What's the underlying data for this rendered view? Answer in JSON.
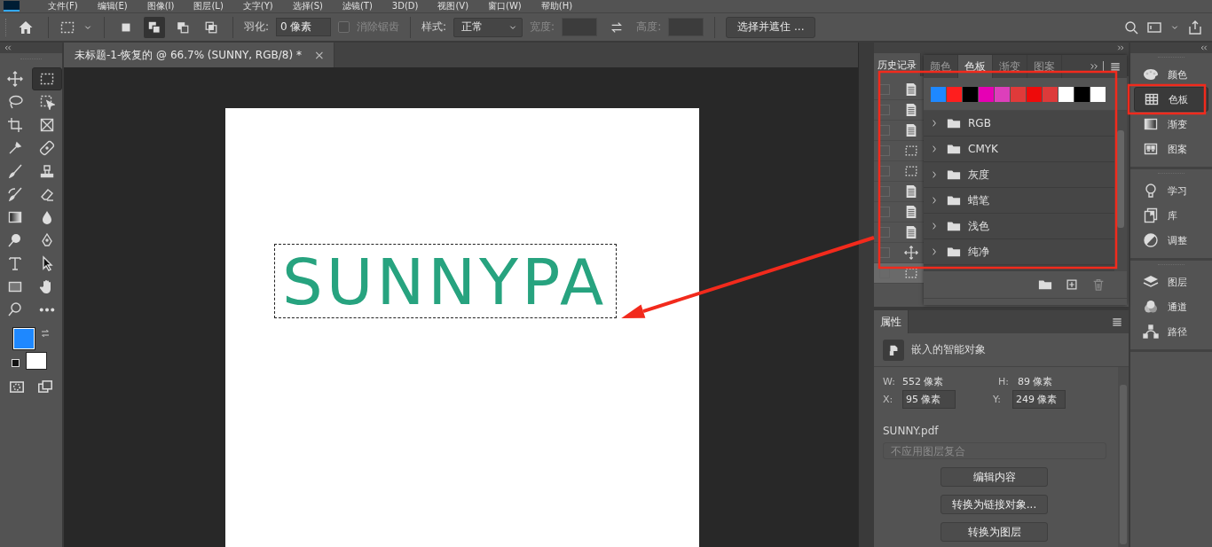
{
  "menu_bar": [
    "文件(F)",
    "编辑(E)",
    "图像(I)",
    "图层(L)",
    "文字(Y)",
    "选择(S)",
    "滤镜(T)",
    "3D(D)",
    "视图(V)",
    "窗口(W)",
    "帮助(H)"
  ],
  "options_bar": {
    "selection_modes": [
      {
        "kind": "new",
        "selected": false
      },
      {
        "kind": "add",
        "selected": true
      },
      {
        "kind": "subtract",
        "selected": false
      },
      {
        "kind": "intersect",
        "selected": false
      }
    ],
    "feather": {
      "label": "羽化:",
      "value": "0 像素"
    },
    "anti_alias": {
      "label": "消除锯齿",
      "checked": false,
      "disabled": true
    },
    "style": {
      "label": "样式:",
      "value": "正常"
    },
    "width": {
      "label": "宽度:",
      "disabled": true
    },
    "height": {
      "label": "高度:",
      "disabled": true
    },
    "select_mask_button": "选择并遮住 ..."
  },
  "tools": [
    {
      "kind": "move",
      "selected": false
    },
    {
      "kind": "marquee",
      "selected": true
    },
    {
      "kind": "lasso",
      "selected": false
    },
    {
      "kind": "object-select",
      "selected": false
    },
    {
      "kind": "crop",
      "selected": false
    },
    {
      "kind": "frame",
      "selected": false
    },
    {
      "kind": "eyedropper",
      "selected": false
    },
    {
      "kind": "healing",
      "selected": false
    },
    {
      "kind": "brush",
      "selected": false
    },
    {
      "kind": "stamp",
      "selected": false
    },
    {
      "kind": "history-brush",
      "selected": false
    },
    {
      "kind": "eraser",
      "selected": false
    },
    {
      "kind": "gradient",
      "selected": false
    },
    {
      "kind": "blur",
      "selected": false
    },
    {
      "kind": "dodge",
      "selected": false
    },
    {
      "kind": "pen",
      "selected": false
    },
    {
      "kind": "type",
      "selected": false
    },
    {
      "kind": "path-select",
      "selected": false
    },
    {
      "kind": "rectangle",
      "selected": false
    },
    {
      "kind": "hand",
      "selected": false
    },
    {
      "kind": "zoom",
      "selected": false
    },
    {
      "kind": "more",
      "selected": false
    }
  ],
  "color_swatches": [
    {
      "kind": "foreground",
      "color": "#1e88ff"
    },
    {
      "kind": "background",
      "color": "#ffffff"
    }
  ],
  "document_tab": {
    "title": "未标题-1-恢复的 @ 66.7% (SUNNY, RGB/8) *",
    "close": "×"
  },
  "canvas": {
    "artwork_text": "SUNNYPA",
    "selection": true
  },
  "history": {
    "tab": "历史记录",
    "rows": [
      {
        "kind": "document",
        "selected": false
      },
      {
        "kind": "document",
        "selected": false
      },
      {
        "kind": "document",
        "selected": false
      },
      {
        "kind": "marquee",
        "selected": false
      },
      {
        "kind": "marquee",
        "selected": false
      },
      {
        "kind": "document",
        "selected": false
      },
      {
        "kind": "document",
        "selected": false
      },
      {
        "kind": "document",
        "selected": false
      },
      {
        "kind": "move",
        "selected": false
      },
      {
        "kind": "marquee",
        "selected": true
      }
    ]
  },
  "swatches_panel": {
    "highlighted": true,
    "tabs": [
      {
        "label": "颜色",
        "selected": false
      },
      {
        "label": "色板",
        "selected": true
      },
      {
        "label": "渐变",
        "selected": false
      },
      {
        "label": "图案",
        "selected": false
      }
    ],
    "swatches": [
      {
        "color": "#1e88ff"
      },
      {
        "color": "#ff1e1e"
      },
      {
        "color": "#000000"
      },
      {
        "color": "#e600b4"
      },
      {
        "color": "#dd3fbb"
      },
      {
        "color": "#e03a3a"
      },
      {
        "color": "#ee0a0a"
      },
      {
        "color": "#dd3a3a"
      },
      {
        "color": "#ffffff"
      },
      {
        "color": "#000000"
      },
      {
        "color": "#ffffff"
      }
    ],
    "groups": [
      {
        "name": "RGB",
        "expanded": false
      },
      {
        "name": "CMYK",
        "expanded": false
      },
      {
        "name": "灰度",
        "expanded": false
      },
      {
        "name": "蜡笔",
        "expanded": false
      },
      {
        "name": "浅色",
        "expanded": false
      },
      {
        "name": "纯净",
        "expanded": false
      }
    ]
  },
  "properties": {
    "tab": "属性",
    "object_type": "嵌入的智能对象",
    "w_label": "W:",
    "w": "552 像素",
    "h_label": "H:",
    "h": "89 像素",
    "x_label": "X:",
    "x": "95 像素",
    "y_label": "Y:",
    "y": "249 像素",
    "file": "SUNNY.pdf",
    "layer_comp": {
      "placeholder": "不应用图层复合"
    },
    "buttons": [
      "编辑内容",
      "转换为链接对象...",
      "转换为图层"
    ]
  },
  "dock": {
    "sections": [
      {
        "items": [
          {
            "kind": "palette",
            "label": "颜色",
            "selected": false
          },
          {
            "kind": "swatches",
            "label": "色板",
            "selected": true
          },
          {
            "kind": "gradient",
            "label": "渐变",
            "selected": false
          },
          {
            "kind": "pattern",
            "label": "图案",
            "selected": false
          }
        ]
      },
      {
        "items": [
          {
            "kind": "bulb",
            "label": "学习",
            "selected": false
          },
          {
            "kind": "library",
            "label": "库",
            "selected": false
          },
          {
            "kind": "adjust",
            "label": "调整",
            "selected": false
          }
        ]
      },
      {
        "items": [
          {
            "kind": "layers",
            "label": "图层",
            "selected": false
          },
          {
            "kind": "channels",
            "label": "通道",
            "selected": false
          },
          {
            "kind": "paths",
            "label": "路径",
            "selected": false
          }
        ]
      }
    ]
  },
  "annotation_arrow": true
}
